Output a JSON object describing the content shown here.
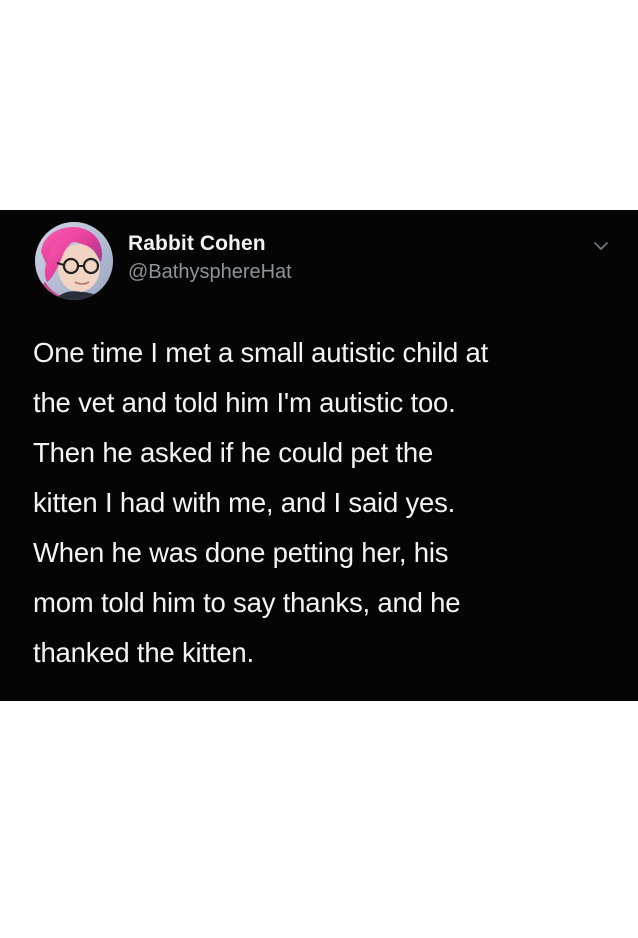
{
  "tweet": {
    "display_name": "Rabbit Cohen",
    "handle": "@BathysphereHat",
    "text": "One time I met a small autistic child at\nthe vet and told him I'm autistic too.\nThen he asked if he could pet the\nkitten I had with me, and I said yes.\nWhen he was done petting her, his\nmom told him to say thanks, and he\nthanked the kitten.",
    "avatar_icon": "profile-avatar-pink-hair-glasses",
    "menu_icon": "chevron-down-icon"
  },
  "colors": {
    "page_background": "#ffffff",
    "card_background": "#050505",
    "display_name": "#f2f2f2",
    "handle": "#8d949b",
    "tweet_text": "#f4f4f4",
    "chevron": "#6e767d"
  }
}
